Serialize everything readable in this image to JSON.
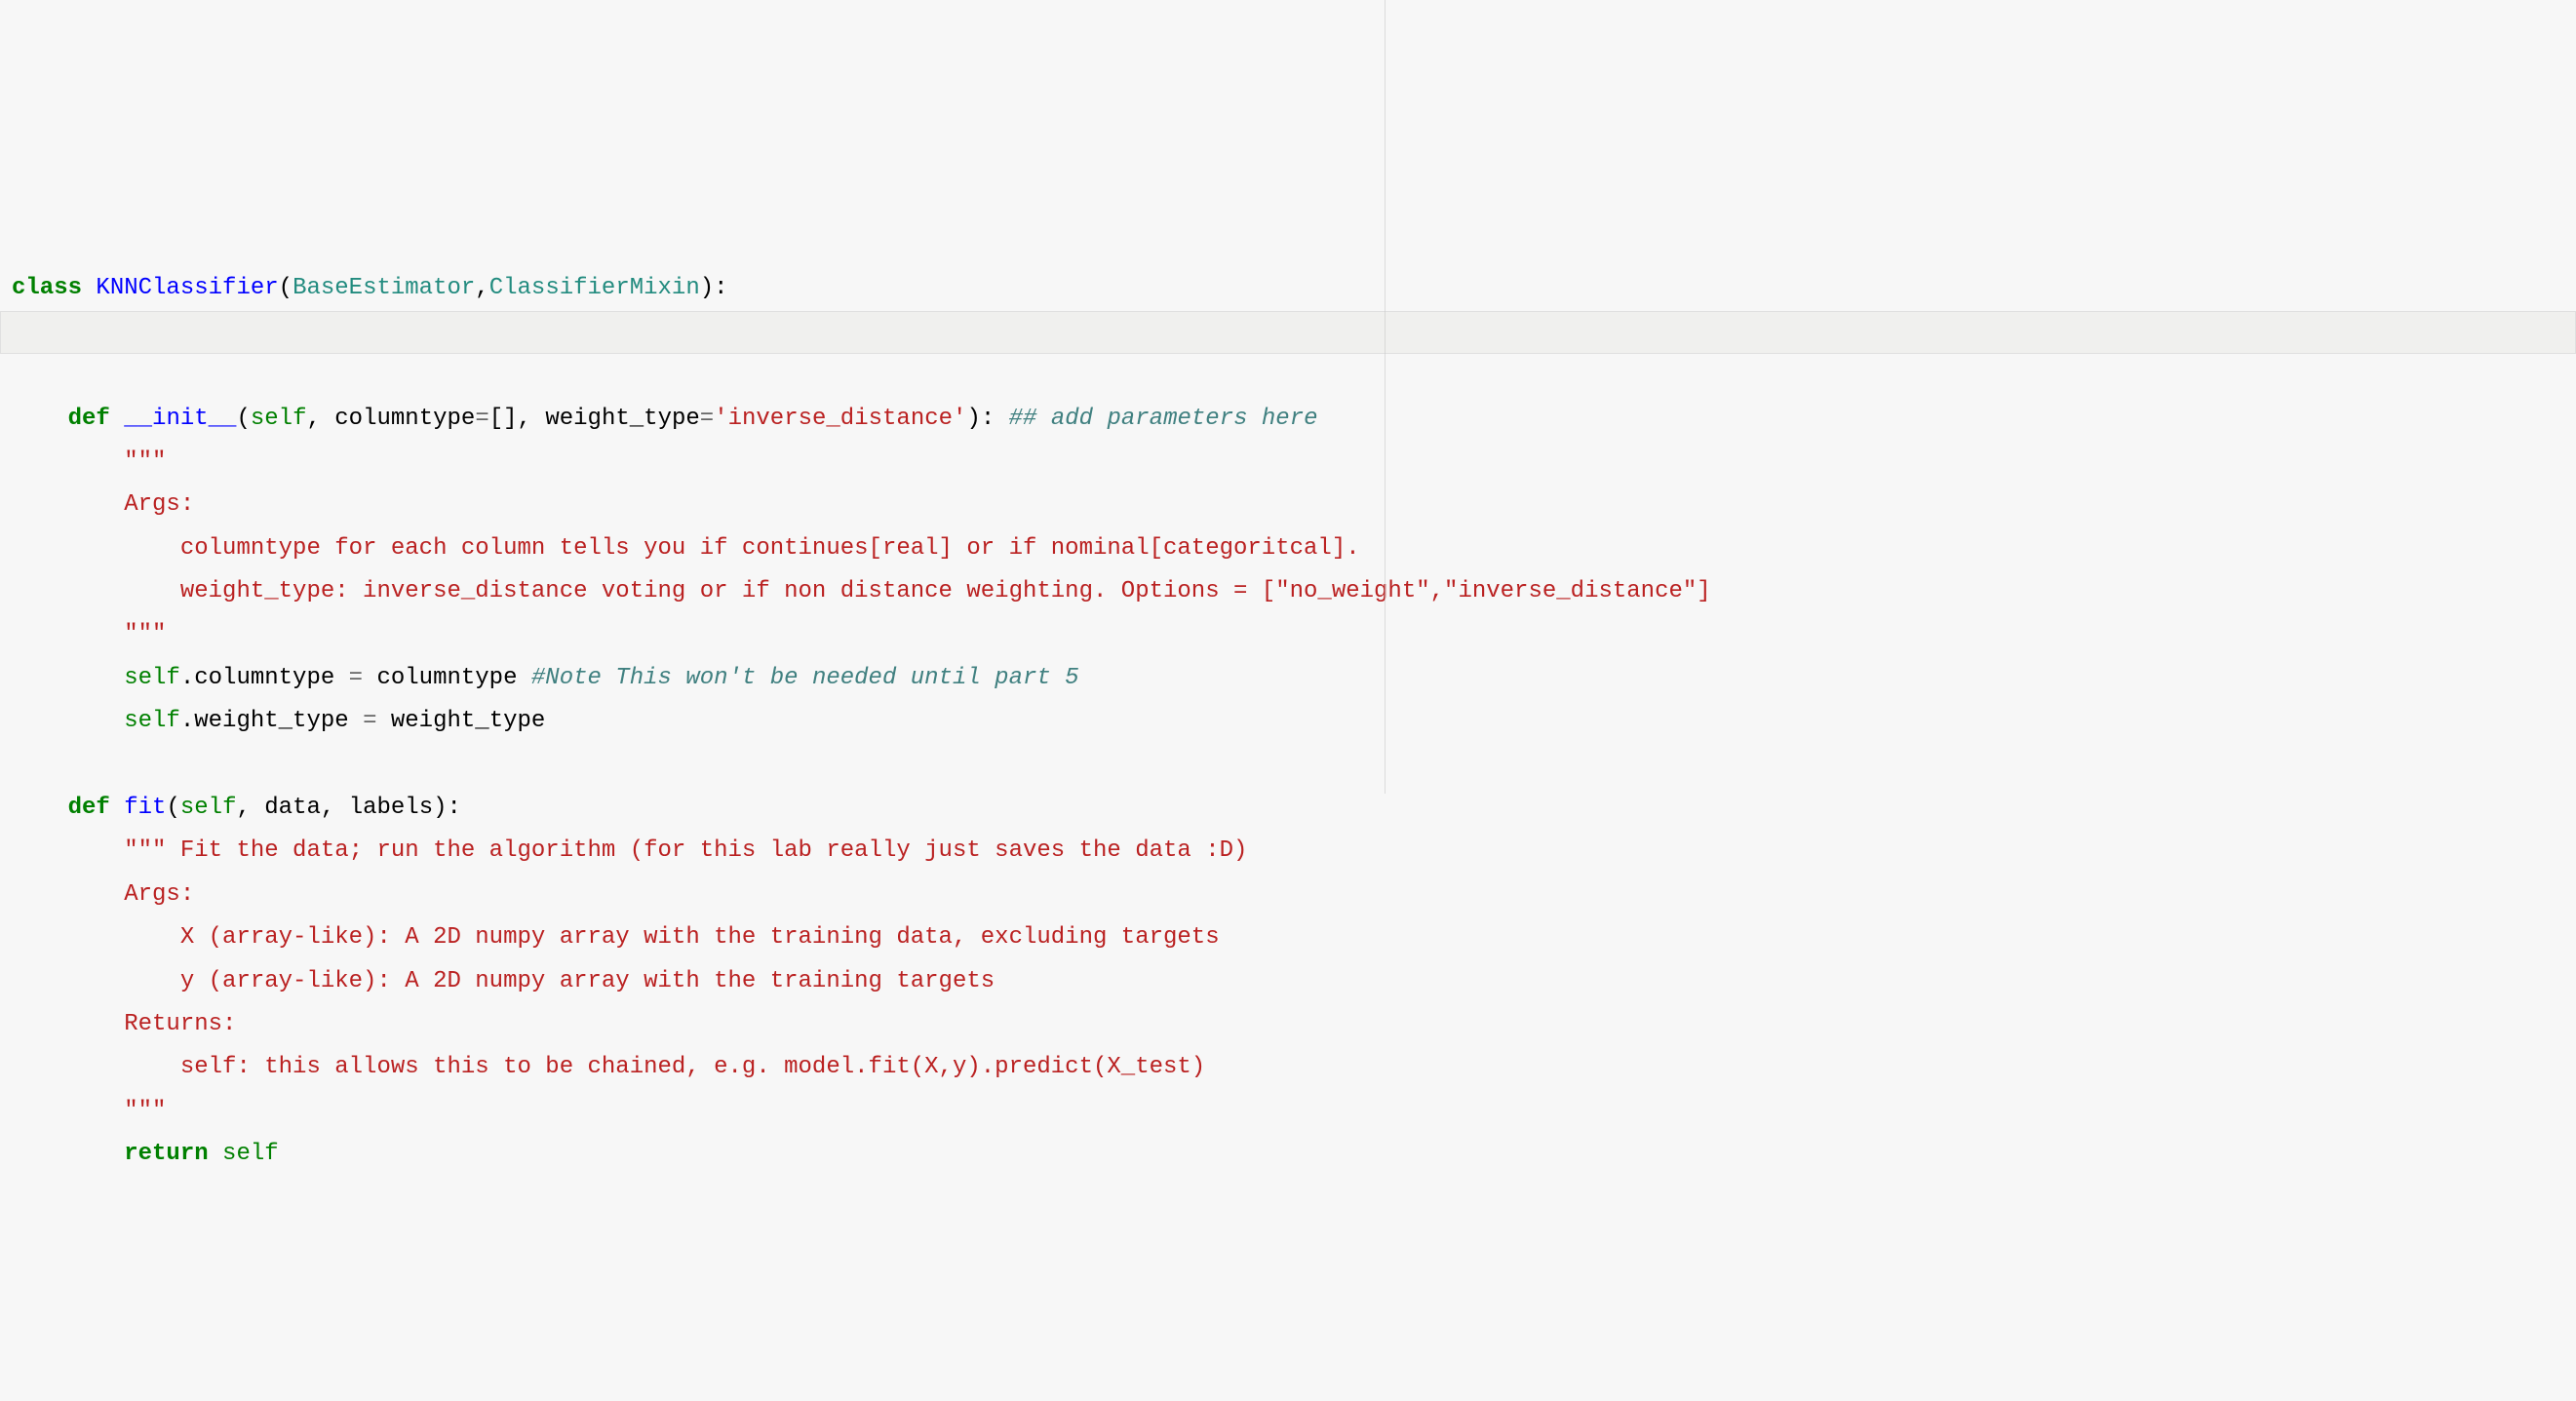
{
  "line1": {
    "kw_class": "class",
    "class_name": "KNNClassifier",
    "base1": "BaseEstimator",
    "comma": ",",
    "base2": "ClassifierMixin",
    "close": "):"
  },
  "init": {
    "kw_def": "def",
    "name": "__init__",
    "sig_open": "(",
    "self": "self",
    "c1": ", ",
    "p1": "columntype",
    "eq1": "=",
    "def1": "[]",
    "c2": ", ",
    "p2": "weight_type",
    "eq2": "=",
    "def2": "'inverse_distance'",
    "sig_close": "):",
    "comment": "## add parameters here",
    "doc_open": "\"\"\"",
    "doc_args": "Args:",
    "doc_l1": "columntype for each column tells you if continues[real] or if nominal[categoritcal].",
    "doc_l2": "weight_type: inverse_distance voting or if non distance weighting. Options = [\"no_weight\",\"inverse_distance\"]",
    "doc_close": "\"\"\"",
    "body1_self": "self",
    "body1_dot": ".columntype ",
    "body1_eq": "=",
    "body1_rhs": " columntype ",
    "body1_comment": "#Note This won't be needed until part 5",
    "body2_self": "self",
    "body2_dot": ".weight_type ",
    "body2_eq": "=",
    "body2_rhs": " weight_type"
  },
  "fit": {
    "kw_def": "def",
    "name": "fit",
    "sig_open": "(",
    "self": "self",
    "c1": ", data, labels):",
    "doc_open": "\"\"\" Fit the data; run the algorithm (for this lab really just saves the data :D)",
    "doc_args": "Args:",
    "doc_x": "X (array-like): A 2D numpy array with the training data, excluding targets",
    "doc_y": "y (array-like): A 2D numpy array with the training targets",
    "doc_returns": "Returns:",
    "doc_ret_line": "self: this allows this to be chained, e.g. model.fit(X,y).predict(X_test)",
    "doc_close": "\"\"\"",
    "ret_kw": "return",
    "ret_self": "self"
  }
}
